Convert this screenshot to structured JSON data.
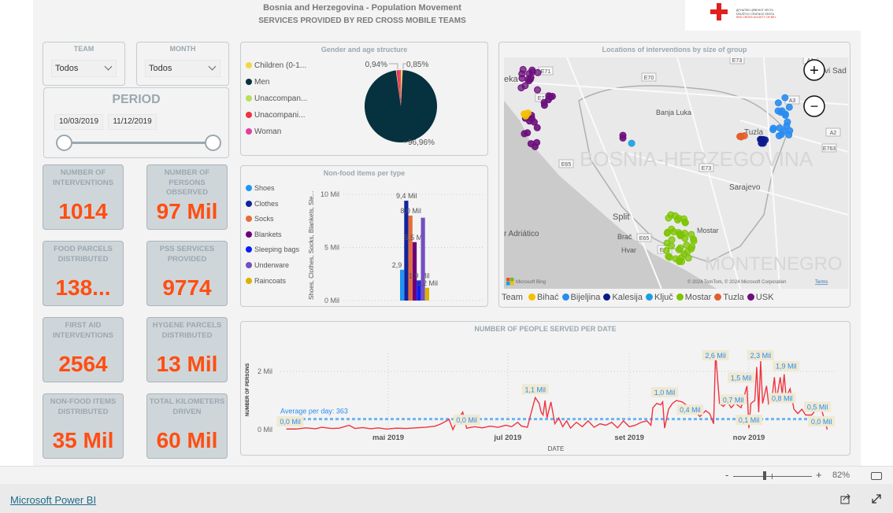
{
  "header": {
    "title": "Bosnia and Herzegovina - Population Movement",
    "subtitle": "SERVICES PROVIDED BY RED CROSS MOBILE TEAMS",
    "logo_text": [
      "ДРУШТВО ЦРВЕНОГ КРСТА/КРИЖА БОСНЕ И ХЕРЦЕГОВИНЕ",
      "DRUŠTVO CRVENOG KRSTA/KRIŽA BOSNE I HERCEGOVINE",
      "RED CROSS SOCIETY OF BOSNIA AND HERZEGOVINA"
    ]
  },
  "filters": {
    "team": {
      "label": "TEAM",
      "value": "Todos"
    },
    "month": {
      "label": "MONTH",
      "value": "Todos"
    },
    "period": {
      "label": "PERIOD",
      "start": "10/03/2019",
      "end": "11/12/2019",
      "slider_range": [
        0,
        1
      ]
    }
  },
  "cards": [
    {
      "label": "NUMBER OF INTERVENTIONS",
      "value": "1014"
    },
    {
      "label": "NUMBER OF PERSONS OBSERVED",
      "value": "97 Mil"
    },
    {
      "label": "FOOD PARCELS DISTRIBUTED",
      "value": "138..."
    },
    {
      "label": "PSS SERVICES PROVIDED",
      "value": "9774"
    },
    {
      "label": "FIRST AID INTERVENTIONS",
      "value": "2564"
    },
    {
      "label": "HYGENE PARCELS DISTRIBUTED",
      "value": "13 Mil"
    },
    {
      "label": "NON-FOOD ITEMS DISTRIBUTED",
      "value": "35 Mil"
    },
    {
      "label": "TOTAL KILOMETERS DRIVEN",
      "value": "60 Mil"
    }
  ],
  "chart_data": [
    {
      "type": "pie",
      "title": "Gender and age structure",
      "legend": [
        {
          "name": "Children (0-1...",
          "color": "#f5d547"
        },
        {
          "name": "Men",
          "color": "#06313f"
        },
        {
          "name": "Unaccompan...",
          "color": "#b7e05a"
        },
        {
          "name": "Unacompani...",
          "color": "#f0333f"
        },
        {
          "name": "Woman",
          "color": "#e041a0"
        }
      ],
      "values": [
        0.85,
        96.96,
        0.3,
        0.95,
        0.94
      ],
      "data_labels": [
        {
          "text": "0,85%",
          "slice": 0
        },
        {
          "text": "96,96%",
          "slice": 1
        },
        {
          "text": "0,94%",
          "slice": 4
        }
      ]
    },
    {
      "type": "bar",
      "title": "Non-food items per type",
      "ylabel": "Shoes, Clothes, Socks, Blankets, Sle...",
      "ylim": [
        0,
        10
      ],
      "yticks": [
        "0 Mil",
        "5 Mil",
        "10 Mil"
      ],
      "grid": true,
      "legend_position": "left",
      "series": [
        {
          "name": "Shoes",
          "value": 2.9,
          "label": "2,9 Mil",
          "color": "#2196f3"
        },
        {
          "name": "Clothes",
          "value": 9.4,
          "label": "9,4 Mil",
          "color": "#12239e"
        },
        {
          "name": "Socks",
          "value": 8.0,
          "label": "8,0 Mil",
          "color": "#e66c37"
        },
        {
          "name": "Blankets",
          "value": 5.5,
          "label": "5,5 Mil",
          "color": "#6b007b"
        },
        {
          "name": "Sleeping bags",
          "value": 1.9,
          "label": "1,9 Mil",
          "color": "#0b1df5"
        },
        {
          "name": "Underware",
          "value": 7.8,
          "label": "",
          "color": "#744ec2"
        },
        {
          "name": "Raincoats",
          "value": 1.2,
          "label": "1,2 Mil",
          "color": "#d9b300"
        }
      ]
    },
    {
      "type": "line",
      "title": "NUMBER OF PEOPLE SERVED PER DATE",
      "xlabel": "DATE",
      "ylabel": "NUMBER OF PERSONS",
      "xticks": [
        {
          "date": "2019-05-01",
          "label": "mai 2019"
        },
        {
          "date": "2019-07-01",
          "label": "jul 2019"
        },
        {
          "date": "2019-09-01",
          "label": "set 2019"
        },
        {
          "date": "2019-11-01",
          "label": "nov 2019"
        }
      ],
      "yticks": [
        {
          "value": 0,
          "label": "0 Mil"
        },
        {
          "value": 2000,
          "label": "2 Mil"
        }
      ],
      "ylim": [
        0,
        2800
      ],
      "grid": true,
      "line_color": "#f0333f",
      "average": {
        "value": 363,
        "label": "Average per day: 363",
        "color": "#6bb5f5"
      },
      "points": [
        [
          "2019-03-10",
          20
        ],
        [
          "2019-03-15",
          20
        ],
        [
          "2019-03-20",
          60
        ],
        [
          "2019-03-25",
          30
        ],
        [
          "2019-03-28",
          80
        ],
        [
          "2019-04-02",
          40
        ],
        [
          "2019-04-06",
          50
        ],
        [
          "2019-04-11",
          150
        ],
        [
          "2019-04-14",
          40
        ],
        [
          "2019-04-18",
          70
        ],
        [
          "2019-04-22",
          30
        ],
        [
          "2019-04-26",
          60
        ],
        [
          "2019-04-30",
          20
        ],
        [
          "2019-05-05",
          50
        ],
        [
          "2019-05-10",
          40
        ],
        [
          "2019-05-15",
          60
        ],
        [
          "2019-05-20",
          80
        ],
        [
          "2019-05-25",
          120
        ],
        [
          "2019-05-28",
          200
        ],
        [
          "2019-06-01",
          350
        ],
        [
          "2019-06-03",
          0
        ],
        [
          "2019-06-05",
          300
        ],
        [
          "2019-06-08",
          600
        ],
        [
          "2019-06-10",
          50
        ],
        [
          "2019-06-14",
          100
        ],
        [
          "2019-06-18",
          60
        ],
        [
          "2019-06-22",
          120
        ],
        [
          "2019-06-26",
          80
        ],
        [
          "2019-06-30",
          150
        ],
        [
          "2019-07-03",
          100
        ],
        [
          "2019-07-06",
          250
        ],
        [
          "2019-07-08",
          120
        ],
        [
          "2019-07-11",
          80
        ],
        [
          "2019-07-13",
          600
        ],
        [
          "2019-07-15",
          1100
        ],
        [
          "2019-07-17",
          900
        ],
        [
          "2019-07-18",
          600
        ],
        [
          "2019-07-19",
          500
        ],
        [
          "2019-07-20",
          1000
        ],
        [
          "2019-07-21",
          400
        ],
        [
          "2019-07-23",
          950
        ],
        [
          "2019-07-25",
          200
        ],
        [
          "2019-07-27",
          400
        ],
        [
          "2019-07-29",
          100
        ],
        [
          "2019-07-31",
          300
        ],
        [
          "2019-08-02",
          50
        ],
        [
          "2019-08-05",
          250
        ],
        [
          "2019-08-08",
          100
        ],
        [
          "2019-08-11",
          300
        ],
        [
          "2019-08-14",
          80
        ],
        [
          "2019-08-17",
          200
        ],
        [
          "2019-08-20",
          150
        ],
        [
          "2019-08-23",
          250
        ],
        [
          "2019-08-26",
          60
        ],
        [
          "2019-08-29",
          300
        ],
        [
          "2019-09-01",
          100
        ],
        [
          "2019-09-04",
          150
        ],
        [
          "2019-09-07",
          250
        ],
        [
          "2019-09-10",
          300
        ],
        [
          "2019-09-12",
          150
        ],
        [
          "2019-09-13",
          750
        ],
        [
          "2019-09-15",
          900
        ],
        [
          "2019-09-17",
          850
        ],
        [
          "2019-09-18",
          950
        ],
        [
          "2019-09-19",
          50
        ],
        [
          "2019-09-21",
          700
        ],
        [
          "2019-09-23",
          900
        ],
        [
          "2019-09-25",
          1000
        ],
        [
          "2019-09-28",
          950
        ],
        [
          "2019-10-01",
          800
        ],
        [
          "2019-10-04",
          650
        ],
        [
          "2019-10-07",
          450
        ],
        [
          "2019-10-10",
          650
        ],
        [
          "2019-10-12",
          550
        ],
        [
          "2019-10-14",
          200
        ],
        [
          "2019-10-15",
          2650
        ],
        [
          "2019-10-17",
          900
        ],
        [
          "2019-10-19",
          800
        ],
        [
          "2019-10-21",
          950
        ],
        [
          "2019-10-23",
          750
        ],
        [
          "2019-10-25",
          900
        ],
        [
          "2019-10-28",
          750
        ],
        [
          "2019-10-31",
          1500
        ],
        [
          "2019-11-01",
          50
        ],
        [
          "2019-11-02",
          900
        ],
        [
          "2019-11-04",
          1000
        ],
        [
          "2019-11-05",
          2150
        ],
        [
          "2019-11-06",
          600
        ],
        [
          "2019-11-07",
          2350
        ],
        [
          "2019-11-08",
          900
        ],
        [
          "2019-11-10",
          1500
        ],
        [
          "2019-11-11",
          900
        ],
        [
          "2019-11-13",
          1200
        ],
        [
          "2019-11-14",
          1800
        ],
        [
          "2019-11-15",
          1000
        ],
        [
          "2019-11-17",
          1800
        ],
        [
          "2019-11-18",
          1200
        ],
        [
          "2019-11-19",
          1900
        ],
        [
          "2019-11-20",
          1100
        ],
        [
          "2019-11-22",
          1400
        ],
        [
          "2019-11-24",
          700
        ],
        [
          "2019-11-26",
          550
        ],
        [
          "2019-11-28",
          700
        ],
        [
          "2019-11-30",
          500
        ],
        [
          "2019-12-03",
          500
        ],
        [
          "2019-12-06",
          750
        ],
        [
          "2019-12-08",
          700
        ],
        [
          "2019-12-11",
          0
        ]
      ],
      "data_labels": [
        [
          "2019-03-12",
          0,
          "0,0 Mil"
        ],
        [
          "2019-06-10",
          50,
          "0,0 Mil"
        ],
        [
          "2019-07-15",
          1100,
          "1,1 Mil"
        ],
        [
          "2019-09-19",
          1000,
          "1,0 Mil"
        ],
        [
          "2019-10-02",
          400,
          "0,4 Mil"
        ],
        [
          "2019-10-15",
          2650,
          "2,6 Mil"
        ],
        [
          "2019-10-24",
          750,
          "0,7 Mil"
        ],
        [
          "2019-10-28",
          1500,
          "1,5 Mil"
        ],
        [
          "2019-11-01",
          50,
          "0,1 Mil"
        ],
        [
          "2019-11-07",
          2350,
          "2,3 Mil"
        ],
        [
          "2019-11-18",
          800,
          "0,8 Mil"
        ],
        [
          "2019-11-20",
          1900,
          "1,9 Mil"
        ],
        [
          "2019-12-06",
          500,
          "0,5 Mil"
        ],
        [
          "2019-12-08",
          0,
          "0,0 Mil"
        ]
      ]
    }
  ],
  "map": {
    "title": "Locations of interventions by size of group",
    "legend_title": "Team",
    "teams": [
      {
        "name": "Bihać",
        "color": "#f5c000"
      },
      {
        "name": "Bijeljina",
        "color": "#2a8cf0"
      },
      {
        "name": "Kalesija",
        "color": "#0a1a8c"
      },
      {
        "name": "Ključ",
        "color": "#1aa0e0"
      },
      {
        "name": "Mostar",
        "color": "#7cc400"
      },
      {
        "name": "Tuzla",
        "color": "#e35f2b"
      },
      {
        "name": "USK",
        "color": "#6b0f7b"
      }
    ],
    "labels": {
      "banja": "Banja Luka",
      "tuzla": "Tuzla",
      "sarajevo": "Sarajevo",
      "split": "Split",
      "mostar": "Mostar",
      "brac": "Brač",
      "hvar": "Hvar",
      "sea": "r Adriático",
      "country": "BOSNIA-HERZEGOVINA",
      "montenegro": "MONTENEGRO",
      "novisad": "vi Sad",
      "rijeka": "eka"
    },
    "roads": [
      "E71",
      "E70",
      "E73",
      "A1",
      "E71",
      "A3",
      "A2",
      "E763",
      "E65",
      "E73",
      "E65",
      "E71"
    ],
    "attribution": "© 2024 TomTom, © 2024 Microsoft Corporation",
    "terms": "Terms",
    "bing": "Microsoft Bing",
    "zoom_in": "+",
    "zoom_out": "−"
  },
  "statusbar": {
    "zoom_minus": "-",
    "zoom_plus": "+",
    "zoom_level": "82%",
    "zoom_fraction": 0.4
  },
  "footer": {
    "link": "Microsoft Power BI"
  }
}
